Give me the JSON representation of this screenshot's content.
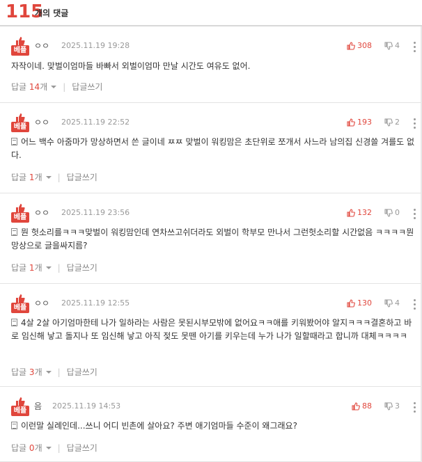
{
  "header": {
    "count": "115",
    "label": "개의 댓글"
  },
  "badge_label": "베플",
  "reply_label": "답글",
  "reply_suffix": "개",
  "write_reply_label": "답글쓰기",
  "accent_color": "#e0463c",
  "comments": [
    {
      "nickname": "ㅇㅇ",
      "date": "2025.11.19 19:28",
      "likes": "308",
      "dislikes": "4",
      "has_doc_icon": false,
      "text": "자작이네. 맞벌이엄마들 바빠서 외벌이엄마 만날 시간도 여유도 없어.",
      "replies": "14"
    },
    {
      "nickname": "ㅇㅇ",
      "date": "2025.11.19 22:52",
      "likes": "193",
      "dislikes": "2",
      "has_doc_icon": true,
      "text": "어느 백수 아줌마가 망상하면서 쓴 글이네 ㅉㅉ 맞벌이 워킹맘은 초단위로 쪼개서 사느라 남의집 신경쓸 겨를도 없다.",
      "replies": "1"
    },
    {
      "nickname": "ㅇㅇ",
      "date": "2025.11.19 23:56",
      "likes": "132",
      "dislikes": "0",
      "has_doc_icon": true,
      "text": "뭔 헛소리를ㅋㅋㅋ맞벌이 워킹맘인데 연차쓰고쉬더라도 외벌이 학부모 만나서 그런헛소리할 시간없음 ㅋㅋㅋㅋ뭔망상으로 글을싸지름?",
      "replies": "1"
    },
    {
      "nickname": "ㅇㅇ",
      "date": "2025.11.19 12:55",
      "likes": "130",
      "dislikes": "4",
      "has_doc_icon": true,
      "text": "4살 2살 아기엄마한테 나가 일하라는 사람은 못된시부모밖에 없어요ㅋㅋ애를 키워봤어야 알지ㅋㅋㅋ결혼하고 바로 임신해 낳고 돌지나 또 임신해 낳고 아직 젖도 못뗀 아기를 키우는데 누가 나가 일할때라고 합니까 대체ㅋㅋㅋㅋ",
      "replies": "3"
    },
    {
      "nickname": "음",
      "date": "2025.11.19 14:53",
      "likes": "88",
      "dislikes": "3",
      "has_doc_icon": true,
      "text": "이런말 실례인데...쓰니 어디 빈촌에 살아요? 주변 애기엄마들 수준이 왜그래요?",
      "replies": "0"
    }
  ]
}
